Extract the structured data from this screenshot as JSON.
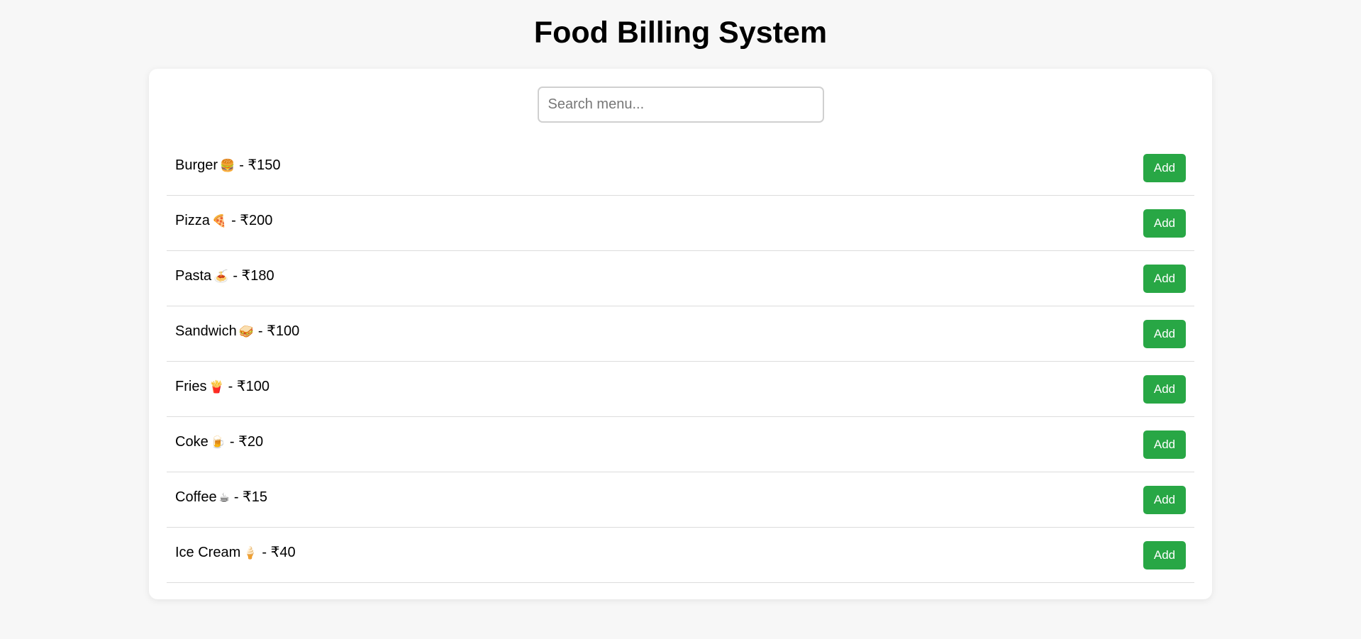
{
  "page": {
    "title": "Food Billing System"
  },
  "search": {
    "placeholder": "Search menu...",
    "value": ""
  },
  "colors": {
    "background": "#f7f7f7",
    "card": "#ffffff",
    "add_button": "#28a745",
    "divider": "#dcdcdc"
  },
  "menu": {
    "items": [
      {
        "name": "Burger",
        "icon": "🍔",
        "icon_name": "burger-icon",
        "price": "₹150",
        "button_label": "Add"
      },
      {
        "name": "Pizza",
        "icon": "🍕",
        "icon_name": "pizza-icon",
        "price": "₹200",
        "button_label": "Add"
      },
      {
        "name": "Pasta",
        "icon": "🍝",
        "icon_name": "pasta-icon",
        "price": "₹180",
        "button_label": "Add"
      },
      {
        "name": "Sandwich",
        "icon": "🥪",
        "icon_name": "sandwich-icon",
        "price": "₹100",
        "button_label": "Add"
      },
      {
        "name": "Fries",
        "icon": "🍟",
        "icon_name": "fries-icon",
        "price": "₹100",
        "button_label": "Add"
      },
      {
        "name": "Coke",
        "icon": "🍺",
        "icon_name": "drink-icon",
        "price": "₹20",
        "button_label": "Add"
      },
      {
        "name": "Coffee",
        "icon": "☕",
        "icon_name": "coffee-icon",
        "price": "₹15",
        "button_label": "Add"
      },
      {
        "name": "Ice Cream",
        "icon": "🍦",
        "icon_name": "ice-cream-icon",
        "price": "₹40",
        "button_label": "Add"
      }
    ]
  }
}
